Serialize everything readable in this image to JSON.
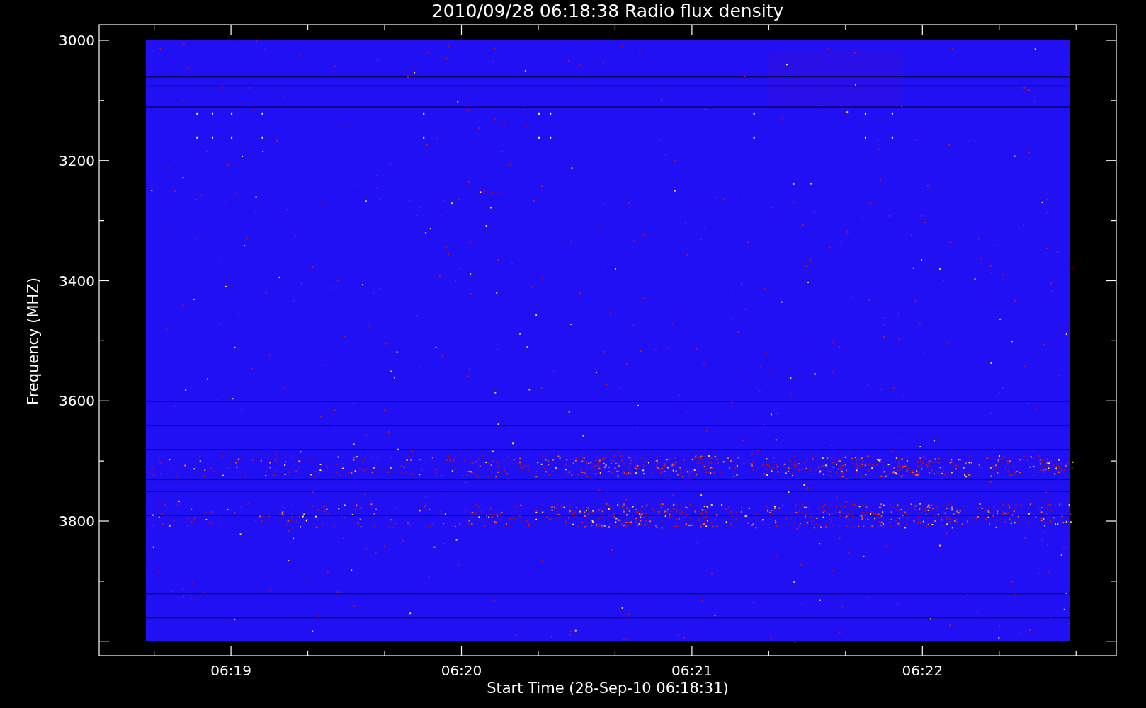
{
  "title": "2010/09/28 06:18:38 Radio flux density",
  "y_axis": {
    "label": "Frequency (MHZ)",
    "ticks": [
      "3000",
      "3200",
      "3400",
      "3600",
      "3800"
    ]
  },
  "x_axis": {
    "label": "Start Time (28-Sep-10 06:18:31)",
    "ticks": [
      "06:19",
      "06:20",
      "06:21",
      "06:22"
    ]
  }
}
